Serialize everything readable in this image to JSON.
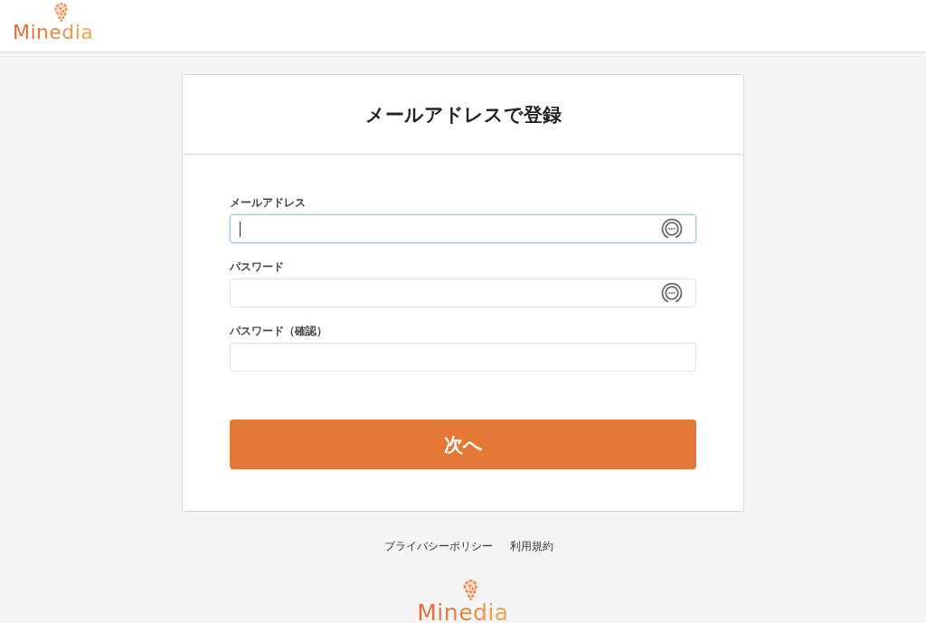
{
  "header": {
    "logo": "Minedia"
  },
  "card": {
    "title": "メールアドレスで登録",
    "fields": [
      {
        "label": "メールアドレス",
        "focused": true,
        "autofill_button": true
      },
      {
        "label": "パスワード",
        "focused": false,
        "autofill_button": true
      },
      {
        "label": "パスワード（確認）",
        "focused": false,
        "autofill_button": false
      }
    ],
    "submit_button": "次へ"
  },
  "footer": {
    "links": [
      "プライバシーポリシー",
      "利用規約"
    ],
    "logo": "Minedia"
  }
}
